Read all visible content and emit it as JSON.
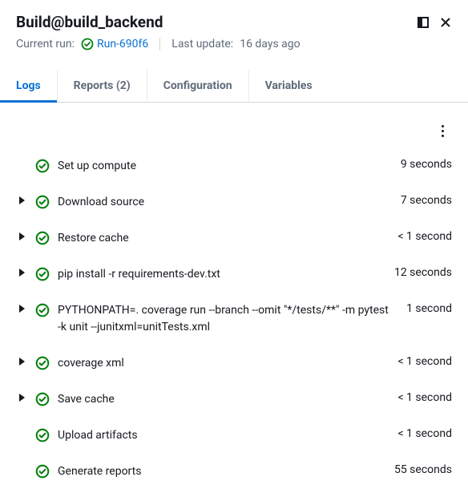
{
  "header": {
    "title": "Build@build_backend",
    "current_run_label": "Current run:",
    "run_link": "Run-690f6",
    "last_update_label": "Last update:",
    "last_update_value": "16 days ago"
  },
  "tabs": [
    {
      "label": "Logs",
      "active": true
    },
    {
      "label": "Reports (2)",
      "active": false
    },
    {
      "label": "Configuration",
      "active": false
    },
    {
      "label": "Variables",
      "active": false
    }
  ],
  "steps": [
    {
      "expandable": false,
      "status": "success",
      "name": "Set up compute",
      "duration": "9 seconds"
    },
    {
      "expandable": true,
      "status": "success",
      "name": "Download source",
      "duration": "7 seconds"
    },
    {
      "expandable": true,
      "status": "success",
      "name": "Restore cache",
      "duration": "< 1 second"
    },
    {
      "expandable": true,
      "status": "success",
      "name": "pip install -r requirements-dev.txt",
      "duration": "12 seconds"
    },
    {
      "expandable": true,
      "status": "success",
      "name": "PYTHONPATH=. coverage run --branch --omit \"*/tests/**\" -m pytest -k unit --junitxml=unitTests.xml",
      "duration": "1 second"
    },
    {
      "expandable": true,
      "status": "success",
      "name": "coverage xml",
      "duration": "< 1 second"
    },
    {
      "expandable": true,
      "status": "success",
      "name": "Save cache",
      "duration": "< 1 second"
    },
    {
      "expandable": false,
      "status": "success",
      "name": "Upload artifacts",
      "duration": "< 1 second"
    },
    {
      "expandable": false,
      "status": "success",
      "name": "Generate reports",
      "duration": "55 seconds"
    }
  ]
}
